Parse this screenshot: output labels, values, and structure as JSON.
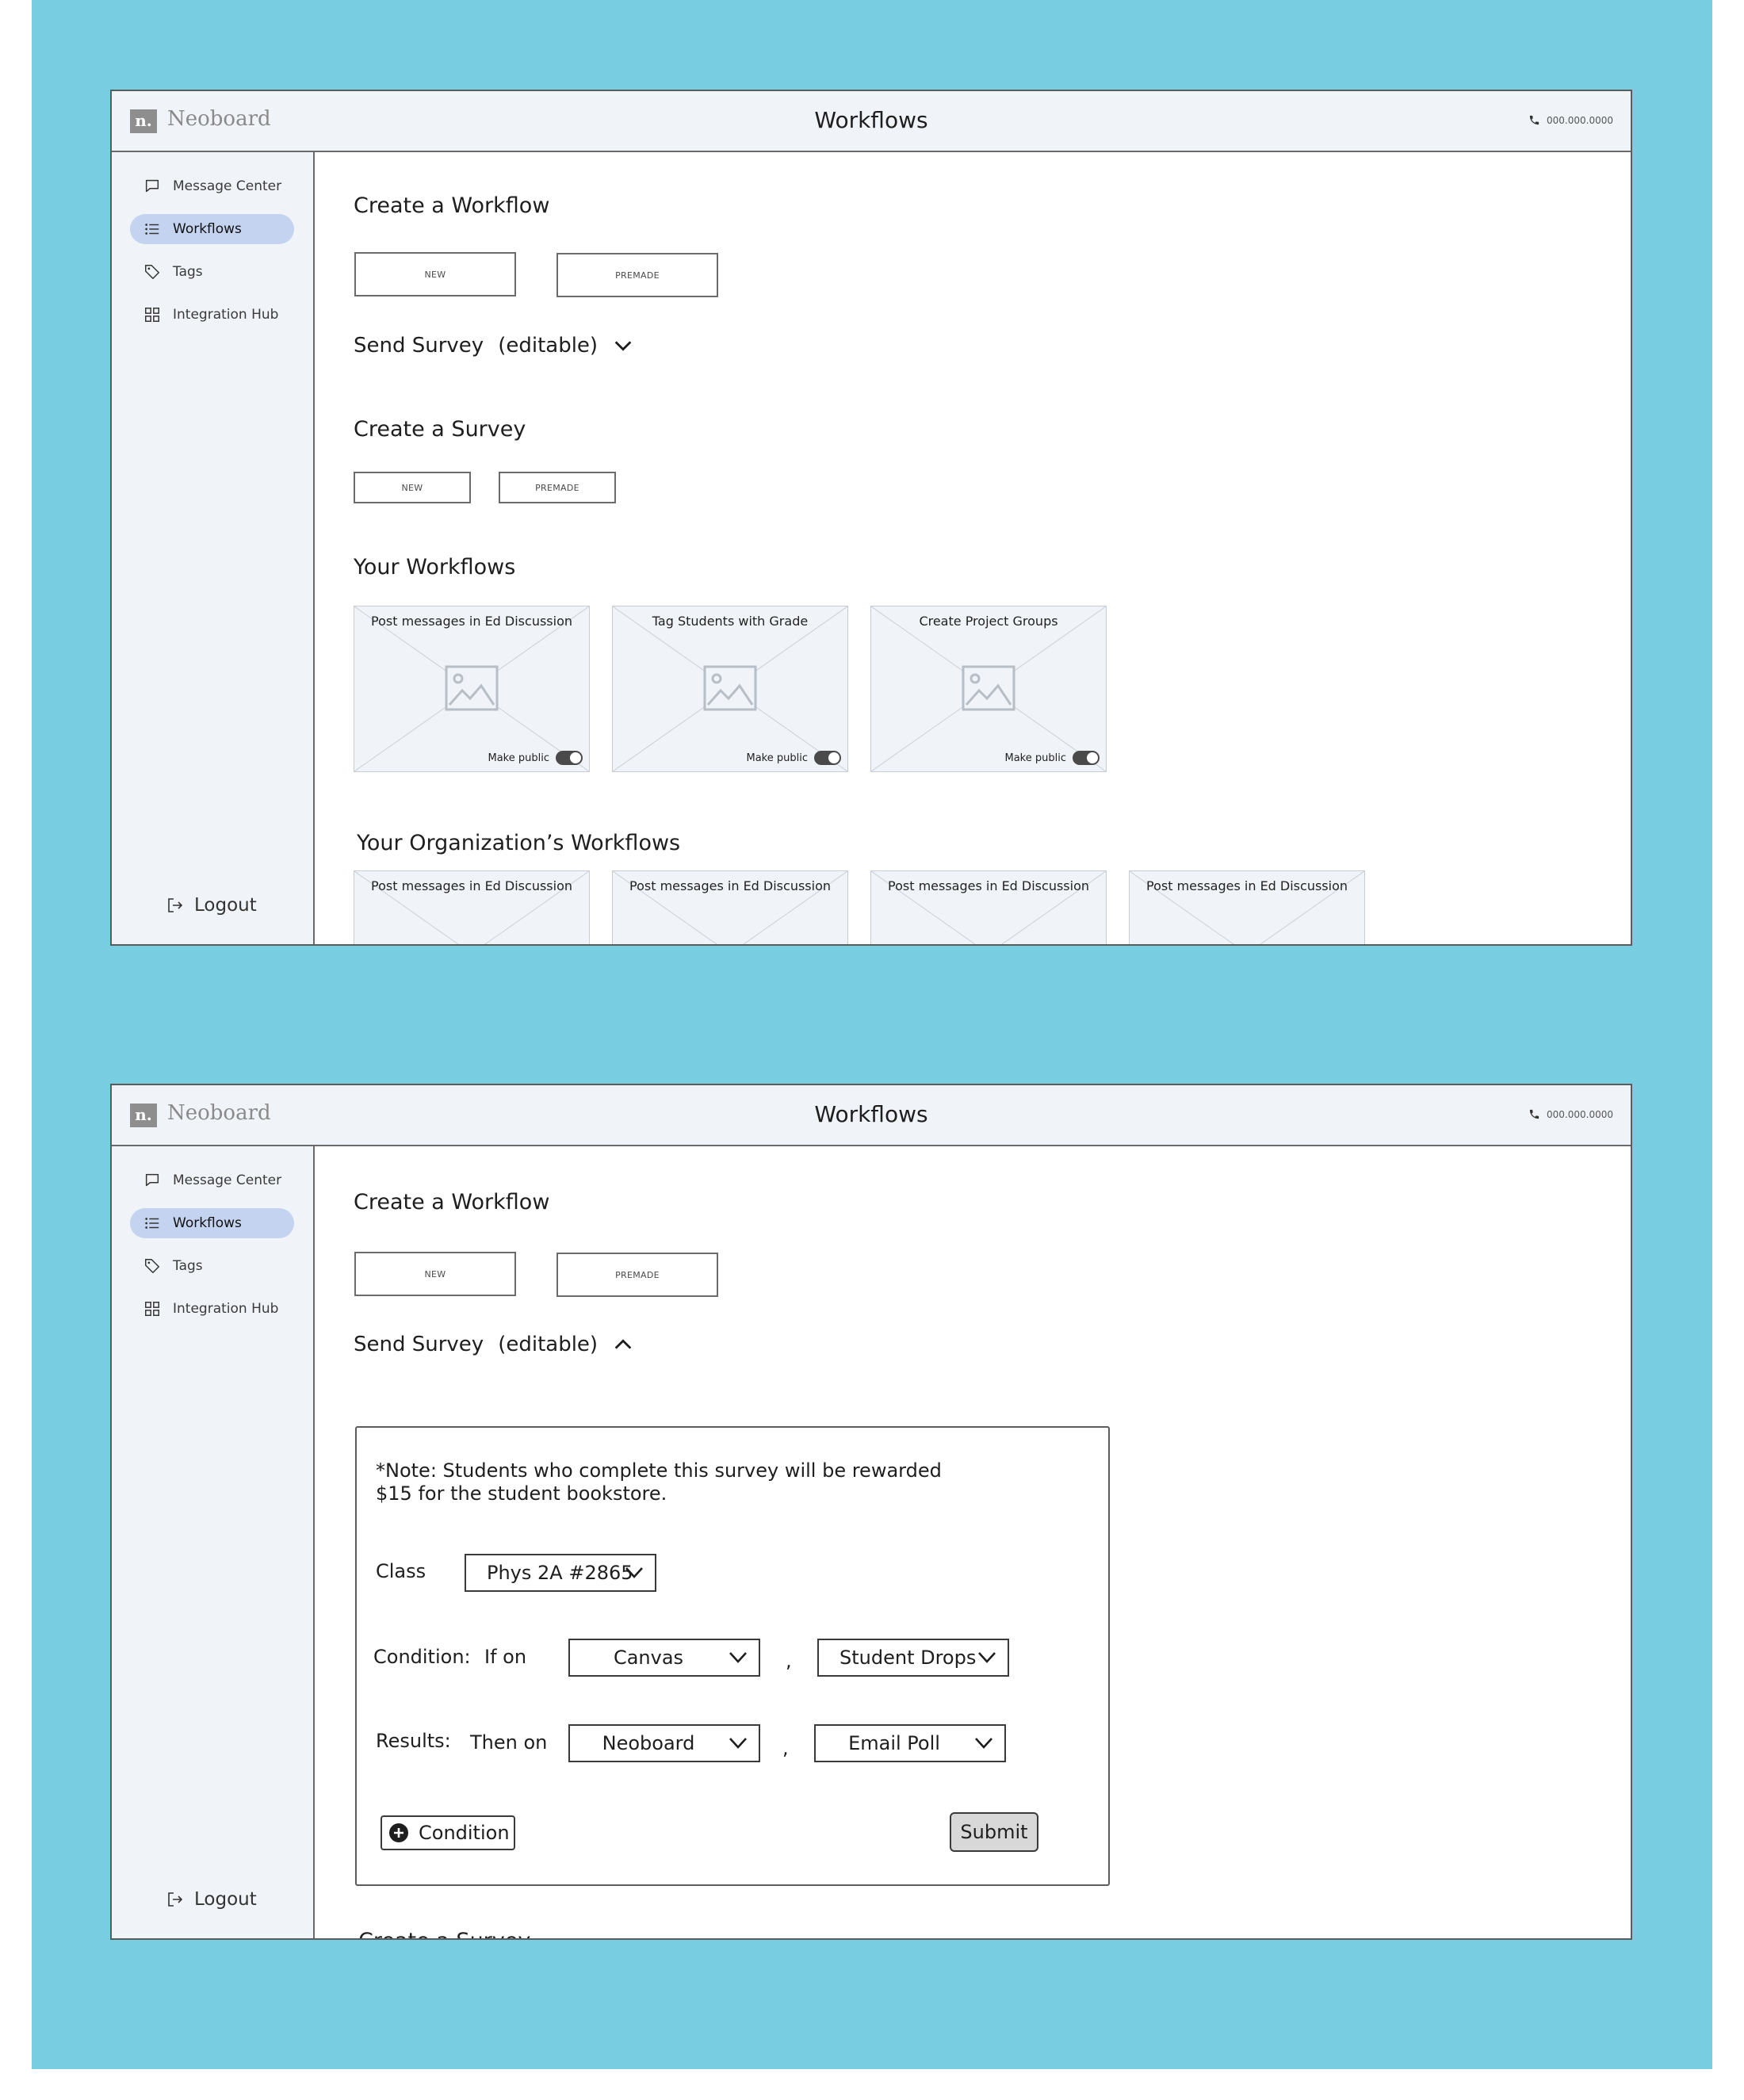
{
  "app": {
    "logo_mark": "n.",
    "logo_text": "Neoboard",
    "page_title": "Workflows",
    "phone": "000.000.0000"
  },
  "sidebar": {
    "items": [
      {
        "label": "Message Center",
        "icon": "chat-bubble-icon",
        "active": false
      },
      {
        "label": "Workflows",
        "icon": "list-icon",
        "active": true
      },
      {
        "label": "Tags",
        "icon": "tag-icon",
        "active": false
      },
      {
        "label": "Integration Hub",
        "icon": "grid-icon",
        "active": false
      }
    ],
    "logout": "Logout"
  },
  "create_workflow": {
    "heading": "Create a Workflow",
    "new_label": "NEW",
    "premade_label": "PREMADE"
  },
  "send_survey": {
    "title": "Send Survey",
    "editable": "(editable)"
  },
  "create_survey": {
    "heading": "Create a Survey",
    "new_label": "NEW",
    "premade_label": "PREMADE"
  },
  "your_workflows": {
    "heading": "Your Workflows",
    "make_public_label": "Make public",
    "cards": [
      {
        "title": "Post messages in Ed Discussion",
        "public": true
      },
      {
        "title": "Tag Students with Grade",
        "public": true
      },
      {
        "title": "Create Project Groups",
        "public": true
      }
    ]
  },
  "org_workflows": {
    "heading": "Your Organization’s Workflows",
    "cards": [
      {
        "title": "Post messages in Ed Discussion"
      },
      {
        "title": "Post messages in Ed Discussion"
      },
      {
        "title": "Post messages in Ed Discussion"
      },
      {
        "title": "Post messages in Ed Discussion"
      }
    ]
  },
  "survey_form": {
    "note_line1": "*Note: Students who complete this survey will be rewarded",
    "note_line2": "$15 for the student bookstore.",
    "class_label": "Class",
    "class_value": "Phys 2A #2865",
    "condition_label": "Condition:",
    "if_on_label": "If on",
    "condition_platform": "Canvas",
    "comma": ",",
    "condition_event": "Student Drops",
    "results_label": "Results:",
    "then_on_label": "Then on",
    "results_platform": "Neoboard",
    "results_action": "Email Poll",
    "add_condition_label": "Condition",
    "submit_label": "Submit"
  },
  "colors": {
    "backdrop": "#79cde1",
    "chrome": "#f0f4f8",
    "active_nav": "#c4d3ef",
    "border": "#5c5c5c"
  }
}
